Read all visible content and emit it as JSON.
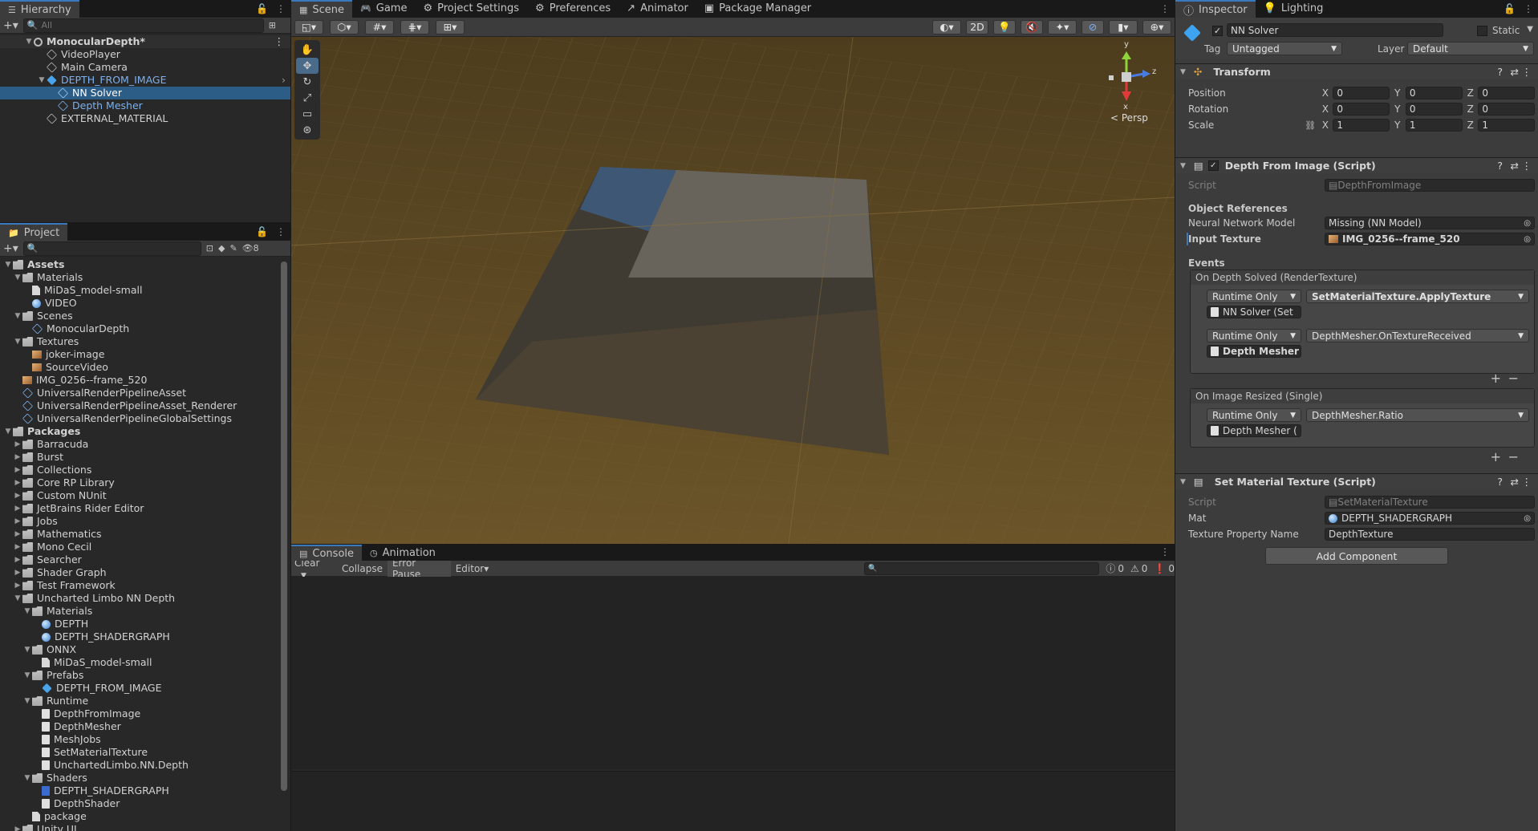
{
  "hierarchy": {
    "tab_label": "Hierarchy",
    "search_placeholder": "All",
    "scene_name": "MonocularDepth*",
    "items": [
      {
        "label": "VideoPlayer"
      },
      {
        "label": "Main Camera"
      },
      {
        "label": "DEPTH_FROM_IMAGE"
      },
      {
        "label": "NN Solver"
      },
      {
        "label": "Depth Mesher"
      },
      {
        "label": "EXTERNAL_MATERIAL"
      }
    ]
  },
  "project": {
    "tab_label": "Project",
    "hidden_count": "8",
    "tree": [
      {
        "label": "Assets"
      },
      {
        "label": "Materials"
      },
      {
        "label": "MiDaS_model-small"
      },
      {
        "label": "VIDEO"
      },
      {
        "label": "Scenes"
      },
      {
        "label": "MonocularDepth"
      },
      {
        "label": "Textures"
      },
      {
        "label": "joker-image"
      },
      {
        "label": "SourceVideo"
      },
      {
        "label": "IMG_0256--frame_520"
      },
      {
        "label": "UniversalRenderPipelineAsset"
      },
      {
        "label": "UniversalRenderPipelineAsset_Renderer"
      },
      {
        "label": "UniversalRenderPipelineGlobalSettings"
      },
      {
        "label": "Packages"
      },
      {
        "label": "Barracuda"
      },
      {
        "label": "Burst"
      },
      {
        "label": "Collections"
      },
      {
        "label": "Core RP Library"
      },
      {
        "label": "Custom NUnit"
      },
      {
        "label": "JetBrains Rider Editor"
      },
      {
        "label": "Jobs"
      },
      {
        "label": "Mathematics"
      },
      {
        "label": "Mono Cecil"
      },
      {
        "label": "Searcher"
      },
      {
        "label": "Shader Graph"
      },
      {
        "label": "Test Framework"
      },
      {
        "label": "Uncharted Limbo NN Depth"
      },
      {
        "label": "Materials"
      },
      {
        "label": "DEPTH"
      },
      {
        "label": "DEPTH_SHADERGRAPH"
      },
      {
        "label": "ONNX"
      },
      {
        "label": "MiDaS_model-small"
      },
      {
        "label": "Prefabs"
      },
      {
        "label": "DEPTH_FROM_IMAGE"
      },
      {
        "label": "Runtime"
      },
      {
        "label": "DepthFromImage"
      },
      {
        "label": "DepthMesher"
      },
      {
        "label": "MeshJobs"
      },
      {
        "label": "SetMaterialTexture"
      },
      {
        "label": "UnchartedLimbo.NN.Depth"
      },
      {
        "label": "Shaders"
      },
      {
        "label": "DEPTH_SHADERGRAPH"
      },
      {
        "label": "DepthShader"
      },
      {
        "label": "package"
      },
      {
        "label": "Unity UI"
      }
    ]
  },
  "top_tabs": {
    "scene": "Scene",
    "game": "Game",
    "project_settings": "Project Settings",
    "preferences": "Preferences",
    "animator": "Animator",
    "package_manager": "Package Manager"
  },
  "scene_view": {
    "mode_2d": "2D",
    "persp_label": "Persp",
    "axis_y": "y",
    "axis_z": "z",
    "axis_x": "x"
  },
  "console": {
    "tab_console": "Console",
    "tab_animation": "Animation",
    "clear": "Clear",
    "collapse": "Collapse",
    "error_pause": "Error Pause",
    "editor": "Editor",
    "count_messages": "0",
    "count_warnings": "0",
    "count_errors": "0"
  },
  "inspector": {
    "tab_inspector": "Inspector",
    "tab_lighting": "Lighting",
    "object_name": "NN Solver",
    "static_label": "Static",
    "tag_label": "Tag",
    "tag_value": "Untagged",
    "layer_label": "Layer",
    "layer_value": "Default",
    "transform": {
      "title": "Transform",
      "position_label": "Position",
      "rotation_label": "Rotation",
      "scale_label": "Scale",
      "x": "X",
      "y": "Y",
      "z": "Z",
      "pos": [
        "0",
        "0",
        "0"
      ],
      "rot": [
        "0",
        "0",
        "0"
      ],
      "scl": [
        "1",
        "1",
        "1"
      ]
    },
    "depth_from_image": {
      "title": "Depth From Image (Script)",
      "script_label": "Script",
      "script_value": "DepthFromImage",
      "obj_refs": "Object References",
      "nn_model_label": "Neural Network Model",
      "nn_model_value": "Missing (NN Model)",
      "input_tex_label": "Input Texture",
      "input_tex_value": "IMG_0256--frame_520",
      "events_label": "Events",
      "on_depth_solved": "On Depth Solved (RenderTexture)",
      "ev1_mode": "Runtime Only",
      "ev1_func": "SetMaterialTexture.ApplyTexture",
      "ev1_obj": "NN Solver (Set",
      "ev2_mode": "Runtime Only",
      "ev2_func": "DepthMesher.OnTextureReceived",
      "ev2_obj": "Depth Mesher",
      "on_image_resized": "On Image Resized (Single)",
      "ev3_mode": "Runtime Only",
      "ev3_func": "DepthMesher.Ratio",
      "ev3_obj": "Depth Mesher (",
      "plus": "+",
      "minus": "−"
    },
    "set_material": {
      "title": "Set Material Texture (Script)",
      "script_label": "Script",
      "script_value": "SetMaterialTexture",
      "mat_label": "Mat",
      "mat_value": "DEPTH_SHADERGRAPH",
      "prop_label": "Texture Property Name",
      "prop_value": "DepthTexture"
    },
    "add_component": "Add Component"
  }
}
